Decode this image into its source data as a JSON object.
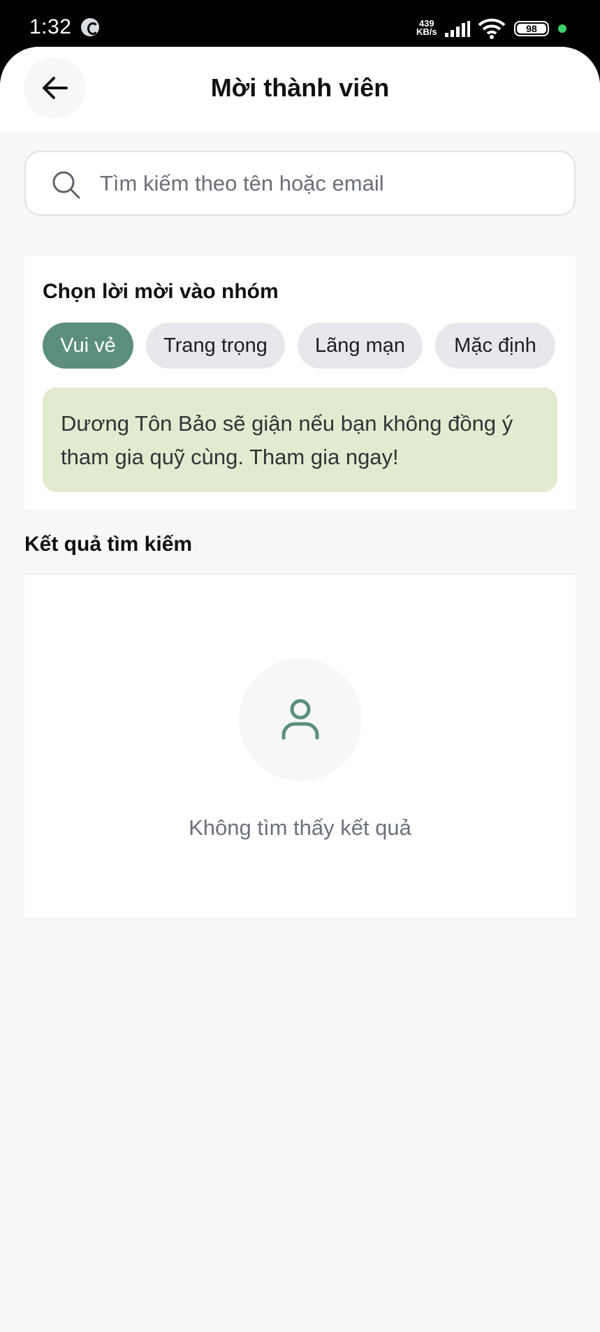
{
  "status_bar": {
    "time": "1:32",
    "net_speed_value": "439",
    "net_speed_unit": "KB/s",
    "battery": "98"
  },
  "header": {
    "title": "Mời thành viên"
  },
  "search": {
    "placeholder": "Tìm kiếm theo tên hoặc email",
    "value": ""
  },
  "invite": {
    "section_title": "Chọn lời mời vào nhóm",
    "styles": [
      {
        "label": "Vui vẻ",
        "selected": true
      },
      {
        "label": "Trang trọng",
        "selected": false
      },
      {
        "label": "Lãng mạn",
        "selected": false
      },
      {
        "label": "Mặc định",
        "selected": false
      }
    ],
    "message": "Dương Tôn Bảo sẽ giận nếu bạn không đồng ý tham gia quỹ cùng. Tham gia ngay!"
  },
  "results": {
    "section_title": "Kết quả tìm kiếm",
    "empty_text": "Không tìm thấy kết quả"
  },
  "colors": {
    "accent": "#5b8f7b",
    "message_bg": "#e2ebd0",
    "chip_bg": "#e8e8ec",
    "page_bg": "#f8f8f9"
  },
  "icons": {
    "back": "arrow-left-icon",
    "search": "search-icon",
    "empty": "user-icon"
  }
}
